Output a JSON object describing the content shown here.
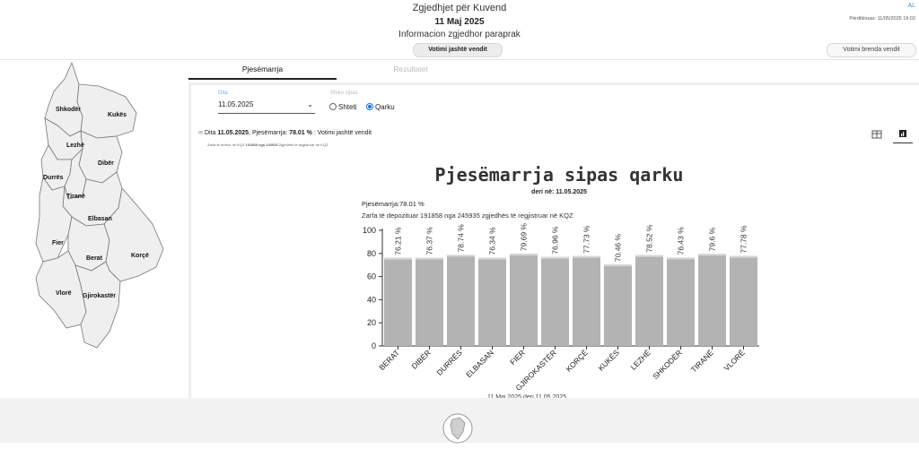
{
  "header": {
    "title": "Zgjedhjet për Kuvend",
    "date": "11 Maj 2025",
    "subtitle": "Informacion zgjedhor paraprak",
    "lang": "AL",
    "updated": "Përditësuar: 11/05/2025 19:02",
    "abroad_button": "Votimi jashtë vendit",
    "inside_button": "Votimi brenda vendit"
  },
  "map": {
    "regions": [
      "Shkodër",
      "Kukës",
      "Lezhë",
      "Dibër",
      "Durrës",
      "Tiranë",
      "Elbasan",
      "Fier",
      "Berat",
      "Korçë",
      "Vlorë",
      "Gjirokastër"
    ],
    "fill": "#efefef",
    "stroke": "#777777"
  },
  "tabs": [
    "Pjesëmarrja",
    "Rezultatet"
  ],
  "filters": {
    "date_label": "Dita",
    "date_value": "11.05.2025",
    "view_label": "Shiko sipas",
    "option_state": "Shteti",
    "option_county": "Qarku"
  },
  "info": {
    "prefix": "Dita",
    "date": "11.05.2025",
    "label": "Pjesëmarrja:",
    "percent": "78.01 %",
    "suffix": "Votimi jashtë vendit",
    "small_a": "Zarfa të ardhur në KQZ",
    "small_n1": "191858",
    "small_b": "nga",
    "small_n2": "245935",
    "small_c": "Zgjedhës të regjistruar në KQZ"
  },
  "chart_data": {
    "type": "bar",
    "title": "Pjesëmarrja sipas qarku",
    "subtitle": "deri në: 11.05.2025",
    "turnout_text": "Pjesëmarrja:78.01 %",
    "info_text": "Zarfa të depozituar 191858 nga 245935 zgjedhës të regjistruar në KQZ",
    "categories": [
      "BERAT",
      "DIBËR",
      "DURRËS",
      "ELBASAN",
      "FIER",
      "GJIROKASTËR",
      "KORÇË",
      "KUKËS",
      "LEZHË",
      "SHKODËR",
      "TIRANË",
      "VLORË"
    ],
    "values": [
      76.21,
      76.37,
      78.74,
      76.34,
      79.69,
      76.96,
      77.73,
      70.46,
      78.52,
      76.43,
      79.6,
      77.78
    ],
    "labels": [
      "76.21 %",
      "76.37 %",
      "78.74 %",
      "76.34 %",
      "79.69 %",
      "76.96 %",
      "77.73 %",
      "70.46 %",
      "78.52 %",
      "76.43 %",
      "79.6 %",
      "77.78 %"
    ],
    "yticks": [
      "0",
      "20",
      "40",
      "60",
      "80",
      "100"
    ],
    "ylim": [
      0,
      100
    ],
    "bar_color": "#b3b3b3",
    "legend_text": "11 Maj 2025 deri 11.05.2025"
  }
}
